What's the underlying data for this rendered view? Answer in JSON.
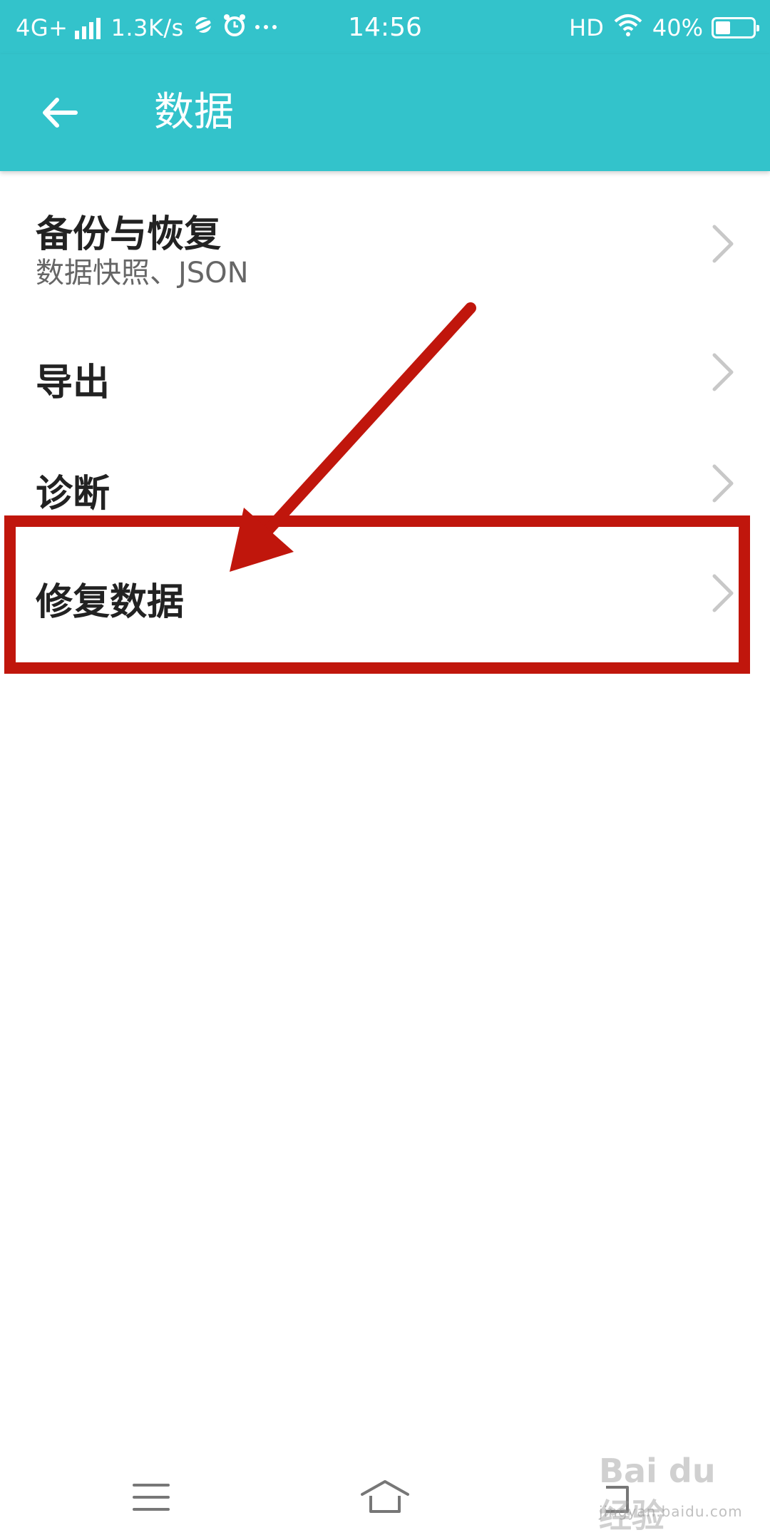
{
  "status_bar": {
    "network": "4G+",
    "speed": "1.3K/s",
    "time": "14:56",
    "hd": "HD",
    "battery": "40%",
    "battery_level": 0.4,
    "icons": [
      "signal-icon",
      "planet-icon",
      "alarm-icon",
      "more-notifications-icon",
      "wifi-icon",
      "battery-icon"
    ]
  },
  "app_bar": {
    "title": "数据",
    "back_icon": "arrow-left-icon"
  },
  "list": {
    "items": [
      {
        "title": "备份与恢复",
        "subtitle": "数据快照、JSON"
      },
      {
        "title": "导出"
      },
      {
        "title": "诊断"
      },
      {
        "title": "修复数据"
      }
    ]
  },
  "annotation": {
    "highlighted_item": "修复数据",
    "color": "#c0160c"
  },
  "nav_bar": {
    "icons": [
      "menu-icon",
      "home-icon",
      "back-icon"
    ]
  },
  "watermark": {
    "logo": "Bai du 经验",
    "url": "jingyan.baidu.com"
  },
  "colors": {
    "accent": "#33c3cb",
    "title_text": "#222222",
    "subtitle_text": "#666666",
    "chevron": "#c8c8c8"
  }
}
